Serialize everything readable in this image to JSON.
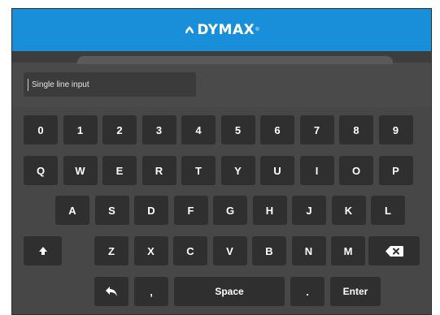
{
  "header": {
    "brand": "DYMAX",
    "brand_mark": "®"
  },
  "input": {
    "placeholder": "Single line input"
  },
  "keyboard": {
    "row1": [
      "0",
      "1",
      "2",
      "3",
      "4",
      "5",
      "6",
      "7",
      "8",
      "9"
    ],
    "row2": [
      "Q",
      "W",
      "E",
      "R",
      "T",
      "Y",
      "U",
      "I",
      "O",
      "P"
    ],
    "row3": [
      "A",
      "S",
      "D",
      "F",
      "G",
      "H",
      "J",
      "K",
      "L"
    ],
    "row4": [
      "Z",
      "X",
      "C",
      "V",
      "B",
      "N",
      "M"
    ],
    "comma": ",",
    "space": "Space",
    "period": ".",
    "enter": "Enter",
    "icons": {
      "shift": "shift-up-arrow-icon",
      "backspace": "backspace-icon",
      "back": "return-back-icon"
    }
  },
  "colors": {
    "header": "#1a8fd9",
    "key": "#2f2f2f",
    "panel": "#4a4a4a"
  }
}
